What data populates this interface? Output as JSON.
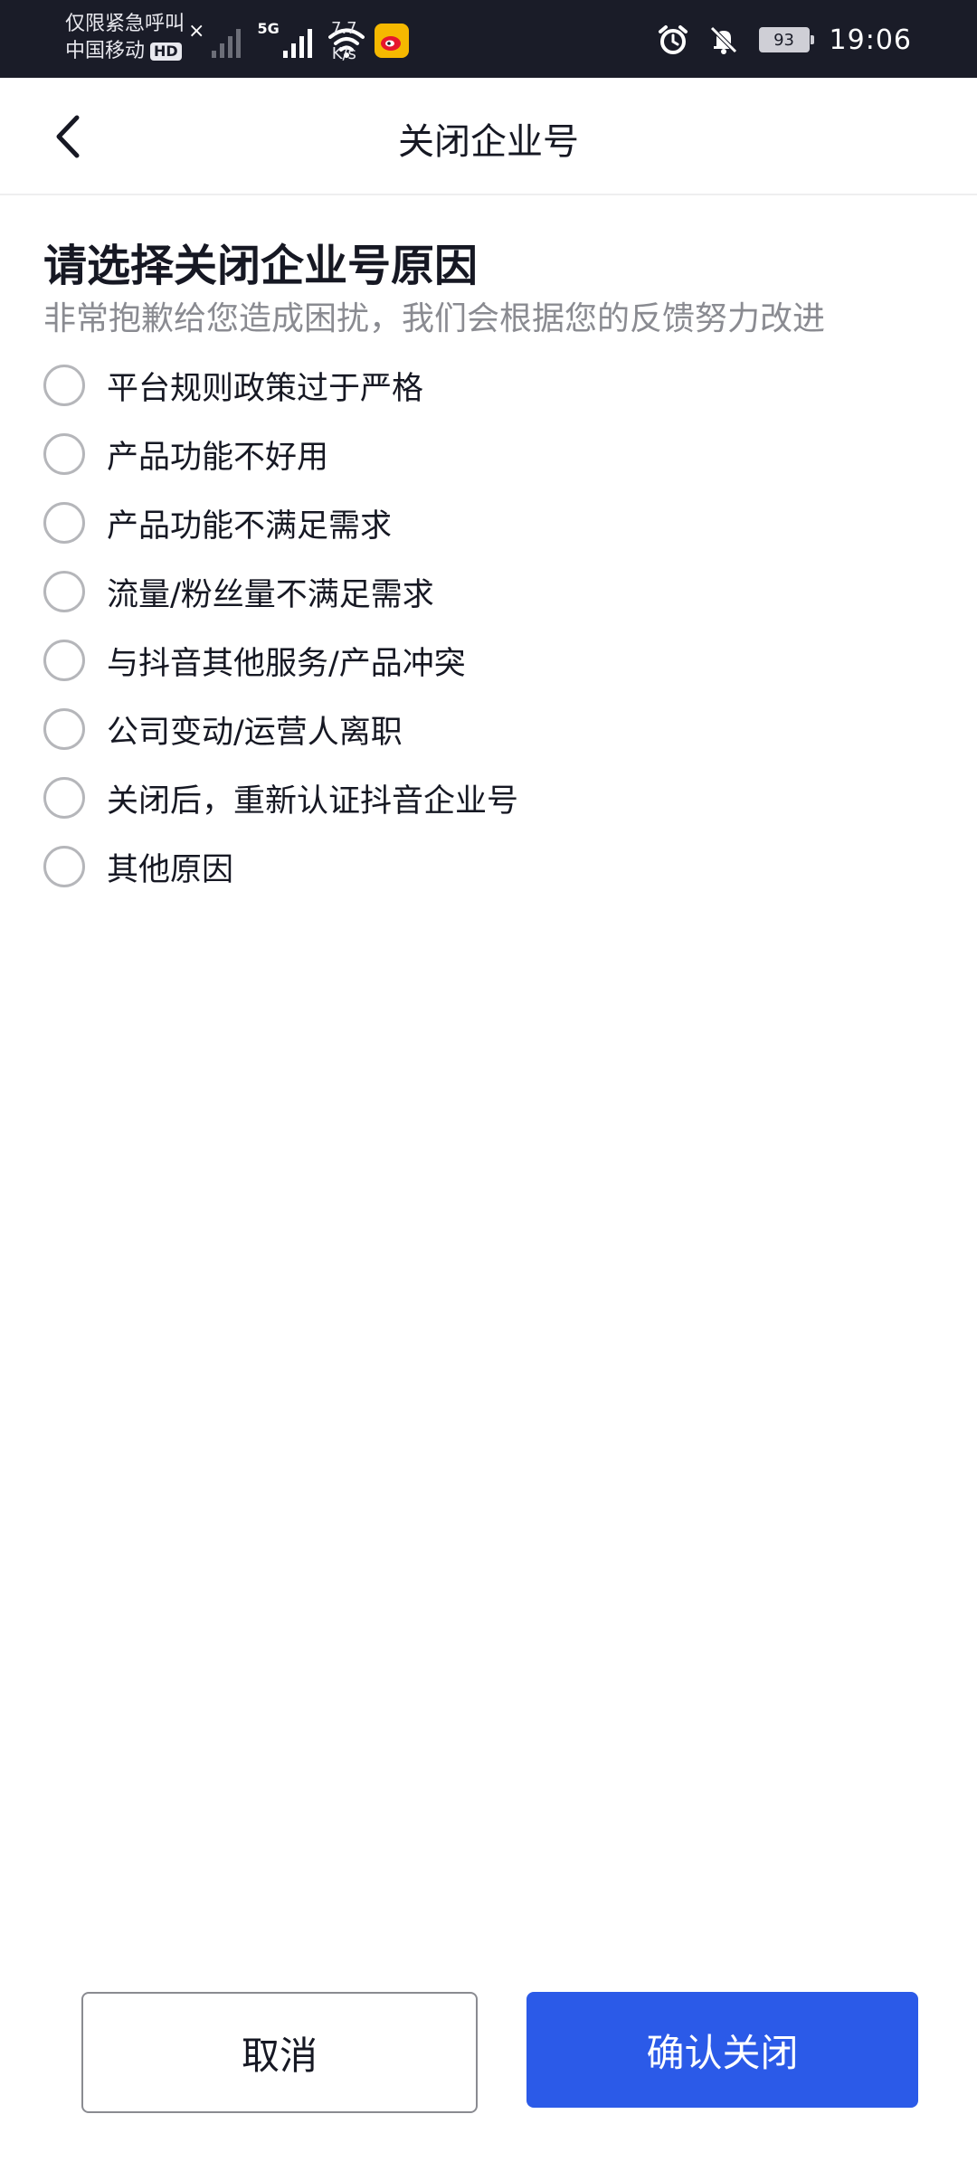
{
  "status_bar": {
    "line1": "仅限紧急呼叫",
    "line2": "中国移动",
    "hd_badge": "HD",
    "network_type": "5G",
    "speed_value": "7.7",
    "speed_unit": "K/s",
    "battery_level": "93",
    "time": "19:06",
    "icons": [
      "signal-icon",
      "wifi-icon",
      "weibo-icon",
      "alarm-icon",
      "mute-icon",
      "battery-icon"
    ]
  },
  "nav": {
    "title": "关闭企业号"
  },
  "content": {
    "heading": "请选择关闭企业号原因",
    "subheading": "非常抱歉给您造成困扰，我们会根据您的反馈努力改进",
    "options": [
      {
        "label": "平台规则政策过于严格",
        "selected": false
      },
      {
        "label": "产品功能不好用",
        "selected": false
      },
      {
        "label": "产品功能不满足需求",
        "selected": false
      },
      {
        "label": "流量/粉丝量不满足需求",
        "selected": false
      },
      {
        "label": "与抖音其他服务/产品冲突",
        "selected": false
      },
      {
        "label": "公司变动/运营人离职",
        "selected": false
      },
      {
        "label": "关闭后，重新认证抖音企业号",
        "selected": false
      },
      {
        "label": "其他原因",
        "selected": false
      }
    ]
  },
  "actions": {
    "cancel_label": "取消",
    "confirm_label": "确认关闭"
  },
  "colors": {
    "primary": "#2b5ae8",
    "status_bar_bg": "#1a1c28",
    "text_primary": "#161823",
    "text_secondary": "#8a8b91",
    "radio_border": "#b5b6ba"
  }
}
